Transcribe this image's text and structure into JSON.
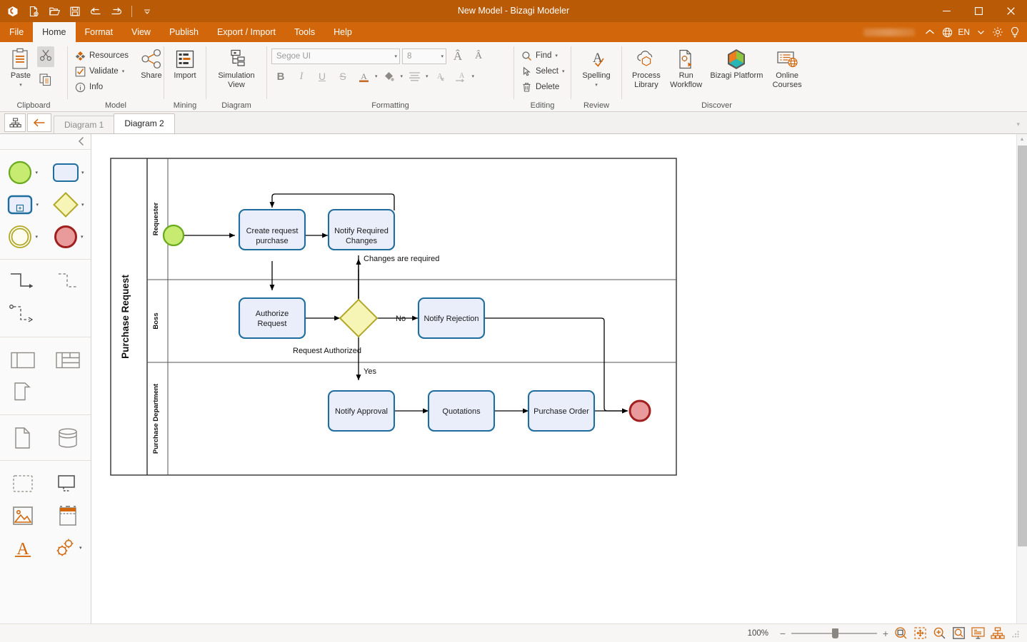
{
  "window": {
    "title": "New Model - Bizagi Modeler",
    "minimize": "─",
    "maximize": "☐",
    "close": "✕"
  },
  "quick_access": {
    "app_icon": "bizagi-logo-icon",
    "buttons": [
      {
        "name": "new-file-icon",
        "tooltip": "New"
      },
      {
        "name": "open-folder-icon",
        "tooltip": "Open"
      },
      {
        "name": "save-icon",
        "tooltip": "Save"
      },
      {
        "name": "undo-icon",
        "tooltip": "Undo"
      },
      {
        "name": "redo-icon",
        "tooltip": "Redo"
      },
      {
        "name": "customize-qat-caret-icon",
        "tooltip": "Customize Quick Access Toolbar"
      }
    ]
  },
  "menu": {
    "items": [
      {
        "label": "File",
        "active": false
      },
      {
        "label": "Home",
        "active": true
      },
      {
        "label": "Format",
        "active": false
      },
      {
        "label": "View",
        "active": false
      },
      {
        "label": "Publish",
        "active": false
      },
      {
        "label": "Export / Import",
        "active": false
      },
      {
        "label": "Tools",
        "active": false
      },
      {
        "label": "Help",
        "active": false
      }
    ],
    "right": {
      "collapse_ribbon": "collapse-ribbon-icon",
      "language_icon": "globe-icon",
      "language": "EN",
      "language_caret": "▾",
      "settings_icon": "gear-icon",
      "help_icon": "lightbulb-icon"
    }
  },
  "ribbon": {
    "groups": [
      {
        "label": "Clipboard",
        "items": [
          {
            "label": "Paste",
            "icon": "clipboard-icon",
            "type": "big",
            "has_caret": true
          },
          {
            "label": "",
            "icon": "cut-scissors-icon",
            "type": "icon"
          },
          {
            "label": "",
            "icon": "copy-icon",
            "type": "icon"
          }
        ]
      },
      {
        "label": "Model",
        "items": [
          {
            "label": "Resources",
            "icon": "resources-icon",
            "type": "small",
            "has_caret": false
          },
          {
            "label": "Validate",
            "icon": "validate-check-icon",
            "type": "small",
            "has_caret": true
          },
          {
            "label": "Info",
            "icon": "info-icon",
            "type": "small",
            "has_caret": false
          },
          {
            "label": "Share",
            "icon": "share-nodes-icon",
            "type": "big",
            "has_caret": false
          }
        ]
      },
      {
        "label": "Mining",
        "items": [
          {
            "label": "Import",
            "icon": "import-table-icon",
            "type": "big",
            "has_caret": false
          }
        ]
      },
      {
        "label": "Diagram",
        "items": [
          {
            "label": "Simulation View",
            "icon": "simulation-view-icon",
            "type": "big",
            "has_caret": false
          }
        ]
      },
      {
        "label": "Formatting",
        "font_name": "Segoe UI",
        "font_size": "8",
        "grow_font_icon": "grow-font-icon",
        "shrink_font_icon": "shrink-font-icon",
        "buttons": [
          {
            "label": "B",
            "name": "bold-button"
          },
          {
            "label": "I",
            "name": "italic-button"
          },
          {
            "label": "U",
            "name": "underline-button"
          },
          {
            "label": "S",
            "name": "strikethrough-button"
          },
          {
            "label": "A",
            "name": "font-color-button"
          },
          {
            "label": "",
            "name": "fill-color-button"
          },
          {
            "label": "",
            "name": "align-button"
          },
          {
            "label": "",
            "name": "clear-format-button"
          },
          {
            "label": "",
            "name": "text-direction-button"
          }
        ]
      },
      {
        "label": "Editing",
        "items": [
          {
            "label": "Find",
            "icon": "search-icon",
            "type": "small",
            "has_caret": true
          },
          {
            "label": "Select",
            "icon": "cursor-select-icon",
            "type": "small",
            "has_caret": true
          },
          {
            "label": "Delete",
            "icon": "trash-icon",
            "type": "small",
            "has_caret": false
          }
        ]
      },
      {
        "label": "Review",
        "items": [
          {
            "label": "Spelling",
            "icon": "spelling-check-icon",
            "type": "big",
            "has_caret": true
          }
        ]
      },
      {
        "label": "Discover",
        "items": [
          {
            "label": "Process Library",
            "icon": "cloud-hexagon-icon",
            "type": "big",
            "has_caret": false
          },
          {
            "label": "Run Workflow",
            "icon": "run-workflow-icon",
            "type": "big",
            "has_caret": false
          },
          {
            "label": "Bizagi Platform",
            "icon": "bizagi-hexagon-icon",
            "type": "big",
            "has_caret": false
          },
          {
            "label": "Online Courses",
            "icon": "online-courses-icon",
            "type": "big",
            "has_caret": false
          }
        ]
      }
    ]
  },
  "tabstrip": {
    "diagram_list_icon": "diagram-list-icon",
    "back_icon": "back-arrow-icon",
    "tabs": [
      {
        "label": "Diagram 1",
        "active": false
      },
      {
        "label": "Diagram 2",
        "active": true
      }
    ],
    "overflow_caret": "▾"
  },
  "palette": {
    "collapse_icon": "chevron-left-icon",
    "sections": [
      {
        "name": "events-activities",
        "rows": [
          [
            {
              "name": "start-event-shape",
              "caret": true
            },
            {
              "name": "task-shape",
              "caret": true
            }
          ],
          [
            {
              "name": "subprocess-shape",
              "caret": true
            },
            {
              "name": "gateway-shape",
              "caret": true
            }
          ],
          [
            {
              "name": "intermediate-event-shape",
              "caret": true
            },
            {
              "name": "end-event-shape",
              "caret": true
            }
          ]
        ]
      },
      {
        "name": "connectors",
        "rows": [
          [
            {
              "name": "sequence-flow-connector",
              "caret": false
            },
            {
              "name": "message-flow-connector",
              "caret": false
            }
          ],
          [
            {
              "name": "association-connector",
              "caret": false
            }
          ]
        ]
      },
      {
        "name": "pools-lanes",
        "rows": [
          [
            {
              "name": "pool-shape",
              "caret": false
            },
            {
              "name": "lane-shape",
              "caret": false
            }
          ],
          [
            {
              "name": "milestone-shape",
              "caret": false
            }
          ]
        ]
      },
      {
        "name": "data-objects",
        "rows": [
          [
            {
              "name": "data-object-shape",
              "caret": false
            },
            {
              "name": "data-store-shape",
              "caret": false
            }
          ]
        ]
      },
      {
        "name": "artifacts",
        "rows": [
          [
            {
              "name": "group-shape",
              "caret": false
            },
            {
              "name": "annotation-shape",
              "caret": false
            }
          ],
          [
            {
              "name": "image-shape",
              "caret": false
            },
            {
              "name": "header-shape",
              "caret": false
            }
          ],
          [
            {
              "name": "text-shape",
              "caret": false
            },
            {
              "name": "custom-shapes-icon",
              "caret": true
            }
          ]
        ]
      }
    ]
  },
  "diagram": {
    "pool_label": "Purchase Request",
    "lanes": [
      {
        "label": "Requester"
      },
      {
        "label": "Boss"
      },
      {
        "label": "Purchase Department"
      }
    ],
    "tasks": [
      {
        "id": "create-request-purchase",
        "label": "Create request purchase"
      },
      {
        "id": "notify-required-changes",
        "label": "Notify Required Changes"
      },
      {
        "id": "authorize-request",
        "label": "Authorize Request"
      },
      {
        "id": "notify-rejection",
        "label": "Notify Rejection"
      },
      {
        "id": "notify-approval",
        "label": "Notify Approval"
      },
      {
        "id": "quotations",
        "label": "Quotations"
      },
      {
        "id": "purchase-order",
        "label": "Purchase Order"
      }
    ],
    "events": [
      {
        "id": "start-event",
        "type": "start"
      },
      {
        "id": "end-event",
        "type": "end"
      }
    ],
    "gateways": [
      {
        "id": "authorized-gateway",
        "type": "exclusive"
      }
    ],
    "flow_labels": [
      {
        "id": "changes-required-label",
        "text": "Changes are required"
      },
      {
        "id": "no-label",
        "text": "No"
      },
      {
        "id": "request-authorized-label",
        "text": "Request Authorized"
      },
      {
        "id": "yes-label",
        "text": "Yes"
      }
    ],
    "colors": {
      "task_fill": "#eaeefb",
      "task_stroke": "#1f6d9c",
      "start_fill": "#c6eb70",
      "start_stroke": "#6aaa1e",
      "end_fill": "#e99a9a",
      "end_stroke": "#a01f1f",
      "gateway_fill": "#f7f5b6",
      "gateway_stroke": "#b1a82a"
    }
  },
  "statusbar": {
    "zoom_level": "100%",
    "zoom_out": "−",
    "zoom_in": "+",
    "buttons": [
      {
        "name": "fit-page-icon"
      },
      {
        "name": "fit-width-icon"
      },
      {
        "name": "zoom-in-glass-icon"
      },
      {
        "name": "zoom-selection-icon"
      },
      {
        "name": "presentation-view-icon"
      },
      {
        "name": "diagram-overview-icon"
      }
    ],
    "grip": "resize-grip-icon"
  }
}
